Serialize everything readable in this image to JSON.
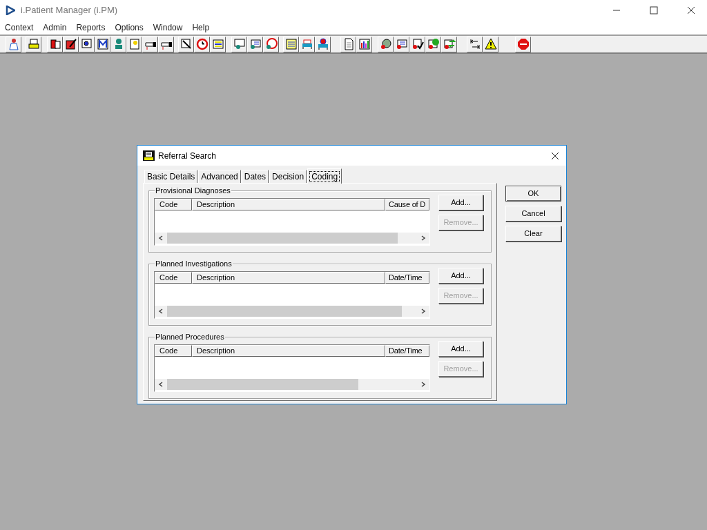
{
  "window": {
    "title": "i.Patient Manager (i.PM)"
  },
  "menu": [
    "Context",
    "Admin",
    "Reports",
    "Options",
    "Window",
    "Help"
  ],
  "dialog": {
    "title": "Referral Search",
    "tabs": [
      {
        "label": "Basic Details",
        "selected": false
      },
      {
        "label": "Advanced",
        "selected": false
      },
      {
        "label": "Dates",
        "selected": false
      },
      {
        "label": "Decision",
        "selected": false
      },
      {
        "label": "Coding",
        "selected": true
      }
    ],
    "groups": [
      {
        "title": "Provisional Diagnoses",
        "columns": [
          "Code",
          "Description",
          "Cause of D"
        ],
        "buttons": [
          {
            "label": "Add...",
            "disabled": false
          },
          {
            "label": "Remove...",
            "disabled": true
          }
        ]
      },
      {
        "title": "Planned Investigations",
        "columns": [
          "Code",
          "Description",
          "Date/Time"
        ],
        "buttons": [
          {
            "label": "Add...",
            "disabled": false
          },
          {
            "label": "Remove...",
            "disabled": true
          }
        ]
      },
      {
        "title": "Planned Procedures",
        "columns": [
          "Code",
          "Description",
          "Date/Time"
        ],
        "buttons": [
          {
            "label": "Add...",
            "disabled": false
          },
          {
            "label": "Remove...",
            "disabled": true
          }
        ]
      }
    ],
    "buttons": [
      {
        "label": "OK",
        "default": true
      },
      {
        "label": "Cancel",
        "default": false
      },
      {
        "label": "Clear",
        "default": false
      }
    ]
  }
}
